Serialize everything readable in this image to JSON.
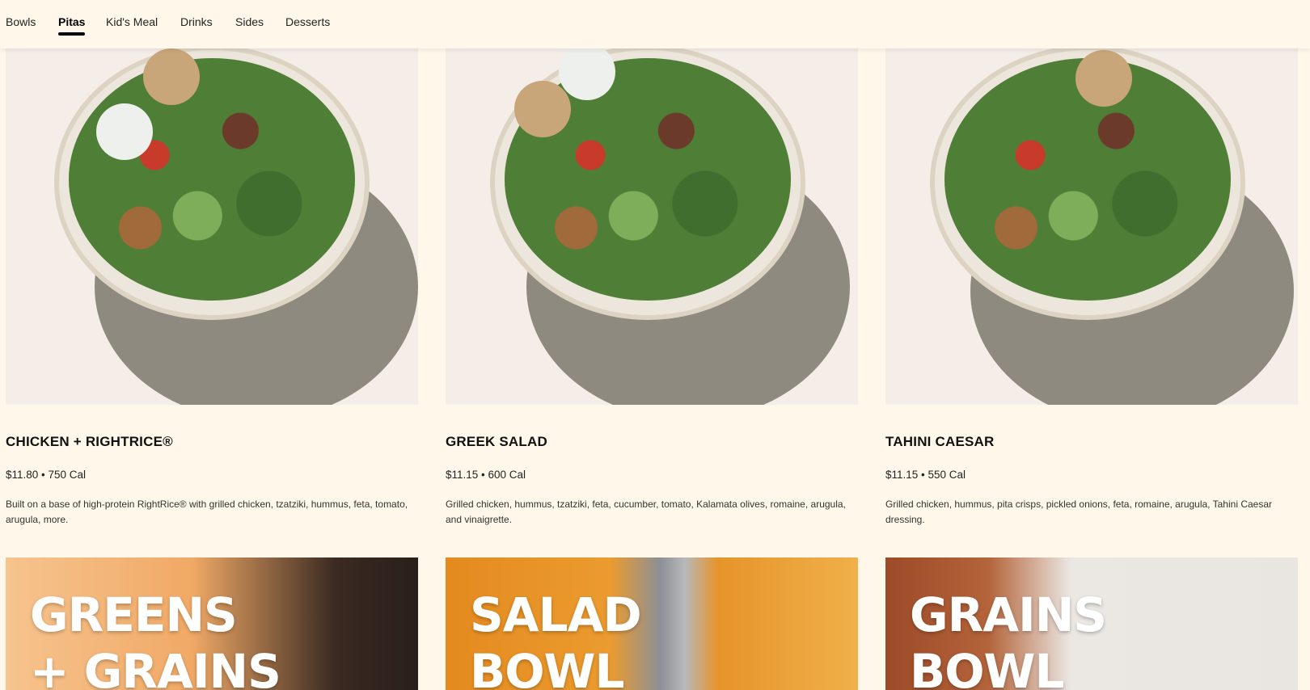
{
  "nav": {
    "tabs": [
      {
        "label": "Bowls",
        "active": false
      },
      {
        "label": "Pitas",
        "active": true
      },
      {
        "label": "Kid's Meal",
        "active": false
      },
      {
        "label": "Drinks",
        "active": false
      },
      {
        "label": "Sides",
        "active": false
      },
      {
        "label": "Desserts",
        "active": false
      }
    ]
  },
  "cards": [
    {
      "title": "CHICKEN + RIGHTRICE®",
      "price": "$11.80 • 750 Cal",
      "description": "Built on a base of high-protein RightRice® with grilled chicken, tzatziki, hummus, feta, tomato, arugula, more."
    },
    {
      "title": "GREEK SALAD",
      "price": "$11.15 • 600 Cal",
      "description": "Grilled chicken, hummus, tzatziki, feta, cucumber, tomato, Kalamata olives, romaine, arugula, and vinaigrette."
    },
    {
      "title": "TAHINI CAESAR",
      "price": "$11.15 • 550 Cal",
      "description": "Grilled chicken, hummus, pita crisps, pickled onions, feta, romaine, arugula, Tahini Caesar dressing."
    }
  ],
  "banners": [
    {
      "line1": "GREENS",
      "line2": "+ GRAINS"
    },
    {
      "line1": "SALAD",
      "line2": "BOWL"
    },
    {
      "line1": "GRAINS",
      "line2": "BOWL"
    }
  ],
  "colors": {
    "page_bg": "#fff8ea",
    "image_bg": "#f5ede7",
    "banner_orange": "#e8922a",
    "banner_grey": "#e9e6e2"
  }
}
